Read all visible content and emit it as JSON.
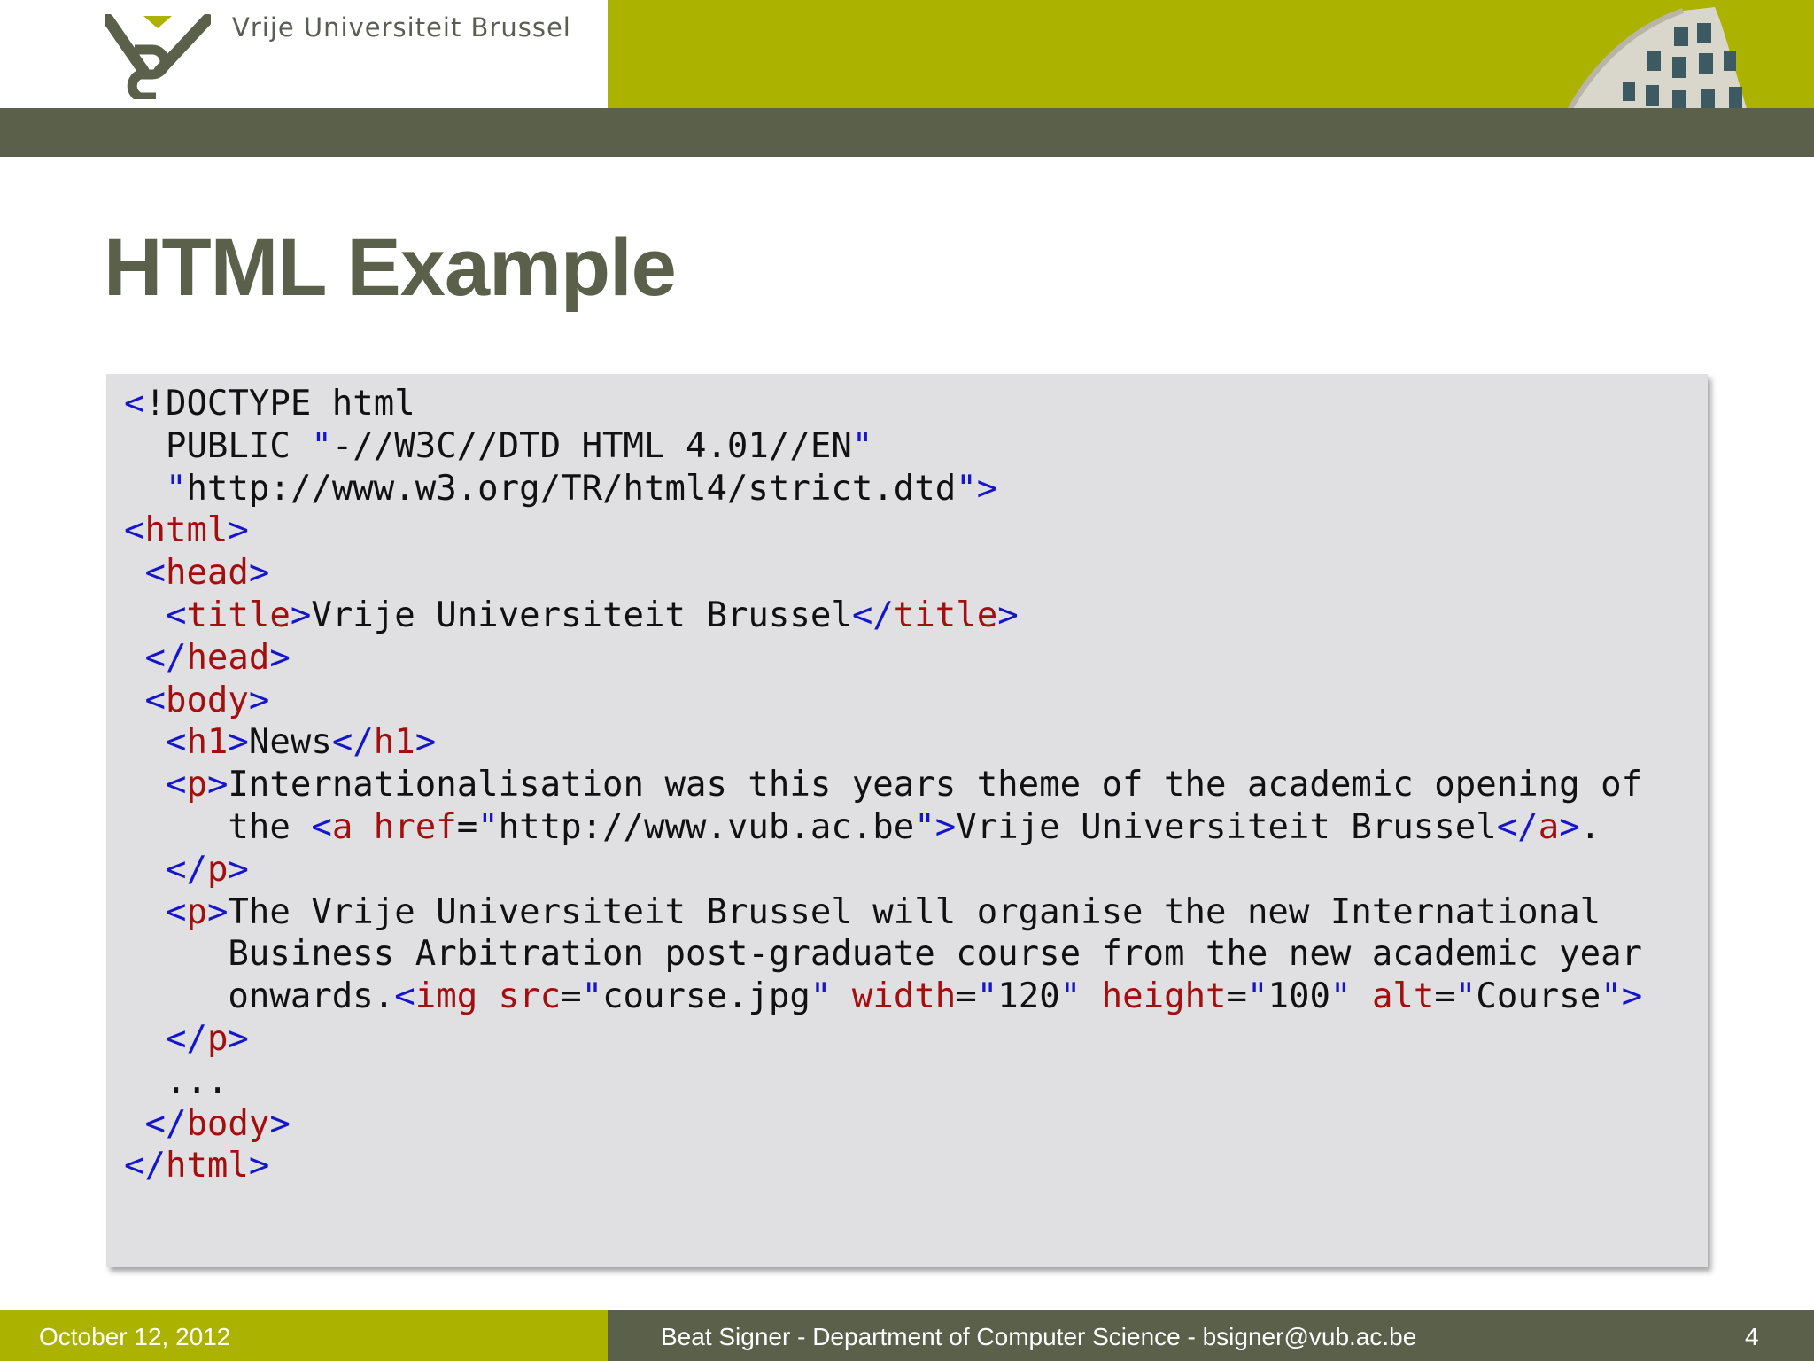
{
  "header": {
    "brand": "Vrije Universiteit  Brussel",
    "logo_icon": "vub-logo-icon",
    "photo": "building-photo"
  },
  "slide": {
    "title": "HTML Example"
  },
  "code_lines": [
    "<!DOCTYPE html",
    "  PUBLIC \"-//W3C//DTD HTML 4.01//EN\"",
    "  \"http://www.w3.org/TR/html4/strict.dtd\">",
    "<html>",
    " <head>",
    "  <title>Vrije Universiteit Brussel</title>",
    " </head>",
    " <body>",
    "  <h1>News</h1>",
    "  <p>Internationalisation was this years theme of the academic opening of",
    "     the <a href=\"http://www.vub.ac.be\">Vrije Universiteit Brussel</a>.",
    "  </p>",
    "  <p>The Vrije Universiteit Brussel will organise the new International",
    "     Business Arbitration post-graduate course from the new academic year",
    "     onwards.<img src=\"course.jpg\" width=\"120\" height=\"100\" alt=\"Course\">",
    "  </p>",
    "  ...",
    " </body>",
    "</html>"
  ],
  "footer": {
    "date": "October 12, 2012",
    "author": "Beat Signer - Department of Computer Science - bsigner@vub.ac.be",
    "page": "4"
  },
  "colors": {
    "olive": "#abb200",
    "dark_band": "#5b604b",
    "code_bg": "#e0dfe2",
    "delimiter": "#1515c9",
    "tag_name": "#a30f0f"
  }
}
